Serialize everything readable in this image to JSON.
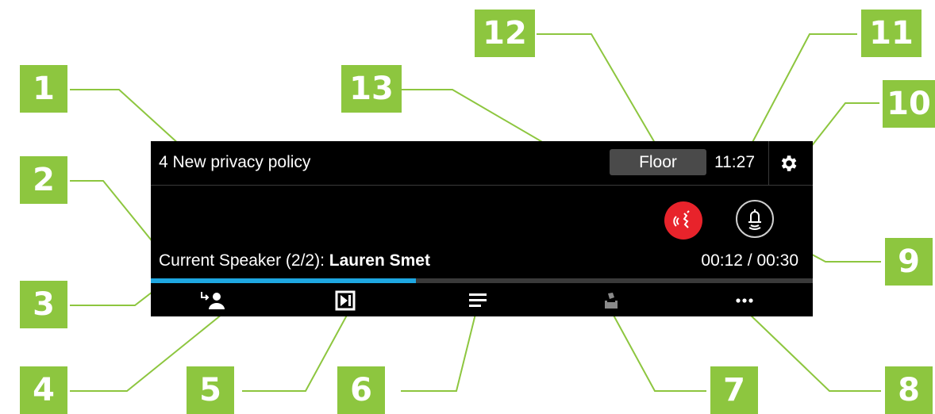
{
  "header": {
    "agenda_item": "4 New privacy policy",
    "floor_label": "Floor",
    "time": "11:27"
  },
  "speaker": {
    "prefix": "Current Speaker (2/2): ",
    "name": "Lauren Smet",
    "timer": "00:12 / 00:30",
    "progress_fraction": 0.4
  },
  "toolbar": {
    "items": [
      "next-speaker-icon",
      "skip-icon",
      "menu-icon",
      "vote-icon",
      "more-icon"
    ]
  },
  "callouts": [
    "1",
    "2",
    "3",
    "4",
    "5",
    "6",
    "7",
    "8",
    "9",
    "10",
    "11",
    "12",
    "13"
  ],
  "colors": {
    "callout_green": "#8dc63f",
    "panel_bg": "#000000",
    "progress_blue": "#1ea7e1",
    "request_red": "#e8232b",
    "floor_gray": "#4a4a4a"
  }
}
